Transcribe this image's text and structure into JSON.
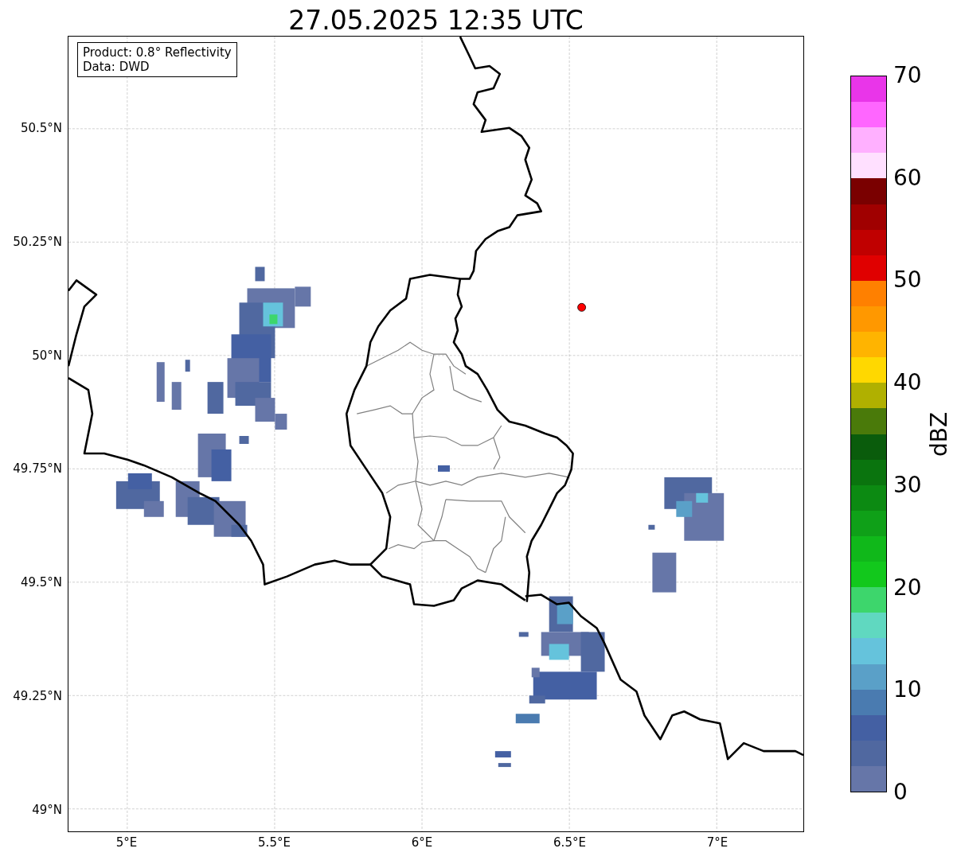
{
  "title": "27.05.2025 12:35 UTC",
  "legend": {
    "lines": [
      "Product: 0.8° Reflectivity",
      "Data: DWD"
    ]
  },
  "axes": {
    "yticks": [
      "50.5°N",
      "50.25°N",
      "50°N",
      "49.75°N",
      "49.5°N",
      "49.25°N",
      "49°N"
    ],
    "xticks": [
      "5°E",
      "5.5°E",
      "6°E",
      "6.5°E",
      "7°E"
    ]
  },
  "colorbar": {
    "label": "dBZ",
    "ticks": [
      "70",
      "60",
      "50",
      "40",
      "30",
      "20",
      "10",
      "0"
    ],
    "segments": [
      {
        "color": "#e935e9"
      },
      {
        "color": "#ff66ff"
      },
      {
        "color": "#ffb0ff"
      },
      {
        "color": "#ffe0ff"
      },
      {
        "color": "#7a0000"
      },
      {
        "color": "#a00000"
      },
      {
        "color": "#c00000"
      },
      {
        "color": "#e00000"
      },
      {
        "color": "#ff8000"
      },
      {
        "color": "#ff9800"
      },
      {
        "color": "#ffb400"
      },
      {
        "color": "#ffd800"
      },
      {
        "color": "#b0b000"
      },
      {
        "color": "#4a7a0a"
      },
      {
        "color": "#0a5c0c"
      },
      {
        "color": "#0a740e"
      },
      {
        "color": "#0c8a12"
      },
      {
        "color": "#0fa018"
      },
      {
        "color": "#10b81a"
      },
      {
        "color": "#12c81c"
      },
      {
        "color": "#3dd66c"
      },
      {
        "color": "#60d8c0"
      },
      {
        "color": "#65c3dc"
      },
      {
        "color": "#5aa0c8"
      },
      {
        "color": "#4a7bb0"
      },
      {
        "color": "#4460a3"
      },
      {
        "color": "#5068a0"
      },
      {
        "color": "#6676a8"
      }
    ]
  }
}
